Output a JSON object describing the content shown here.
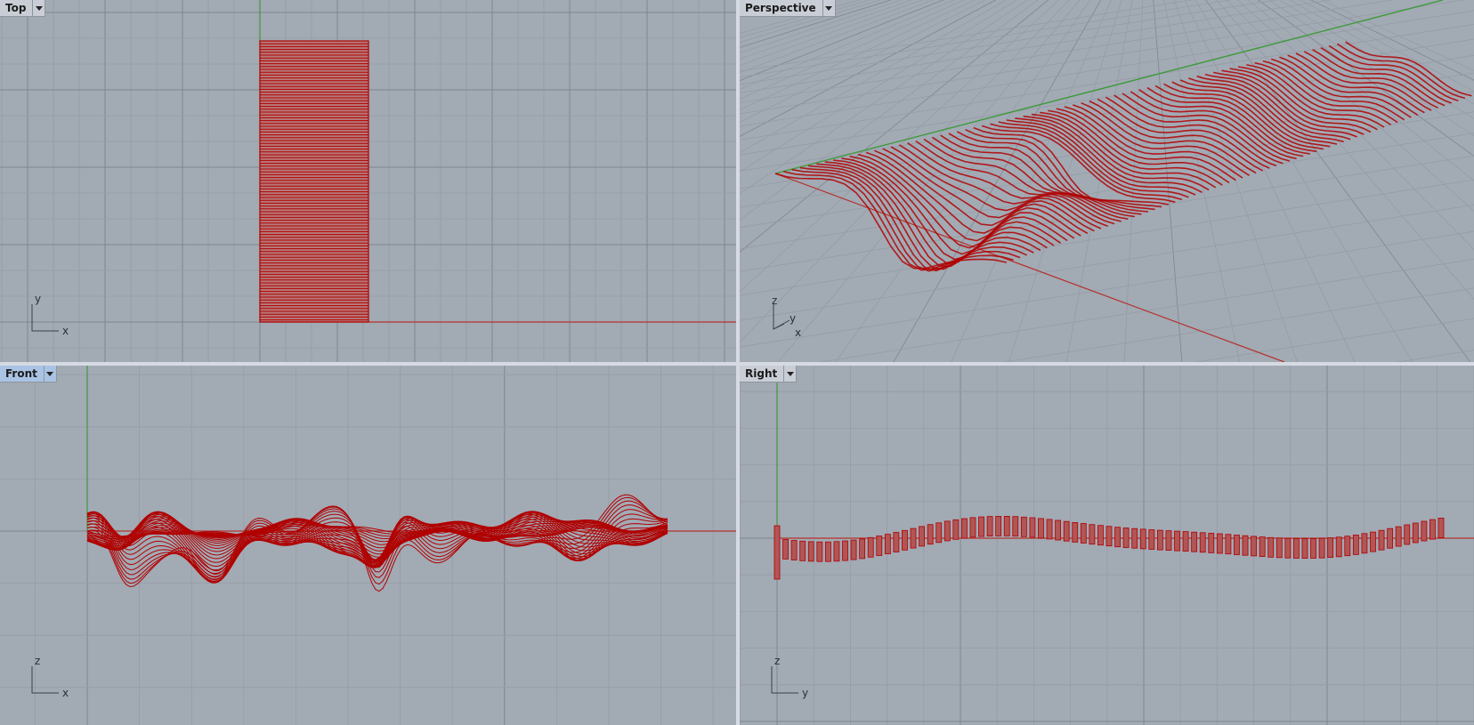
{
  "viewports": {
    "top": {
      "title": "Top",
      "axis_h": "x",
      "axis_v": "y"
    },
    "perspective": {
      "title": "Perspective",
      "axis_a": "z",
      "axis_b": "y",
      "axis_c": "x"
    },
    "front": {
      "title": "Front",
      "axis_h": "x",
      "axis_v": "z",
      "active": true
    },
    "right": {
      "title": "Right",
      "axis_h": "y",
      "axis_v": "z"
    }
  },
  "colors": {
    "viewport_bg": "#a2aab4",
    "grid_minor": "#959ca7",
    "grid_major": "#7f8691",
    "x_axis": "#b4332c",
    "y_axis": "#3e9a3a",
    "geometry": "#b00000",
    "active_tab": "#a9c3e4"
  },
  "icons": {
    "viewport_menu": "chevron-down-icon"
  }
}
